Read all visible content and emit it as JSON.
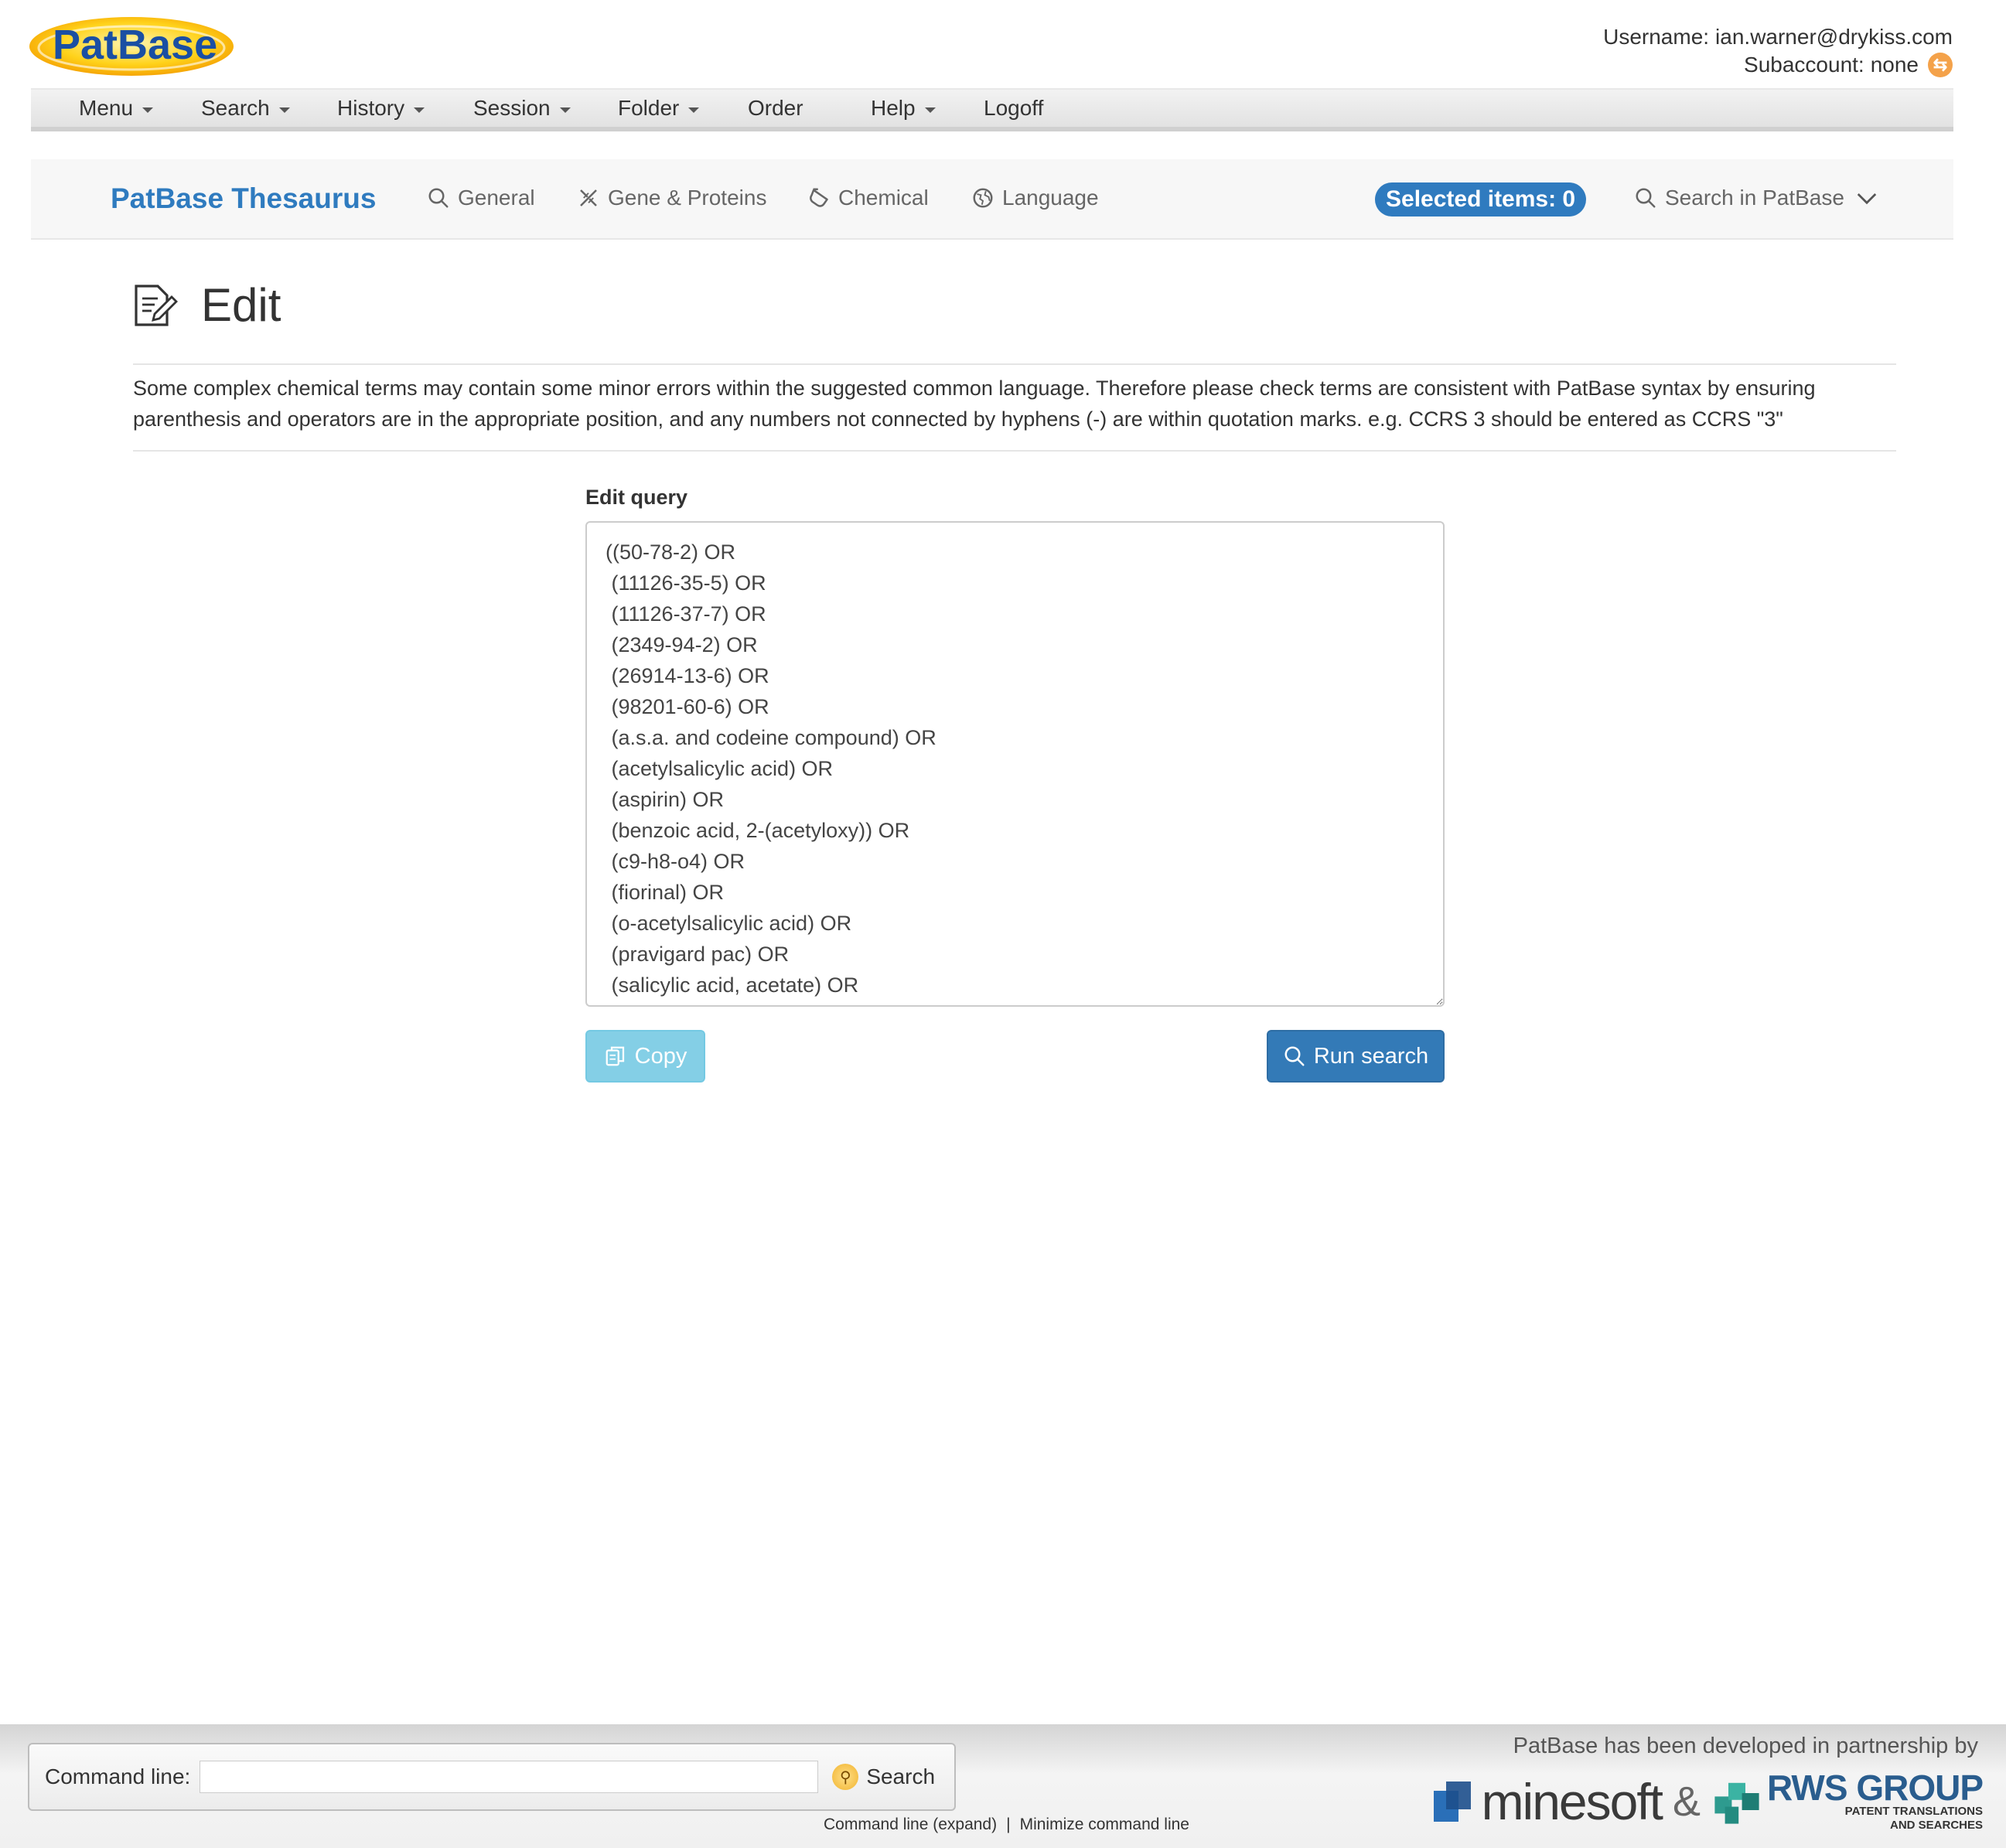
{
  "header": {
    "logo_text": "PatBase",
    "username_label": "Username:",
    "username": "ian.warner@drykiss.com",
    "subaccount_label": "Subaccount:",
    "subaccount": "none"
  },
  "menubar": {
    "items": [
      {
        "label": "Menu",
        "dropdown": true
      },
      {
        "label": "Search",
        "dropdown": true
      },
      {
        "label": "History",
        "dropdown": true
      },
      {
        "label": "Session",
        "dropdown": true
      },
      {
        "label": "Folder",
        "dropdown": true
      },
      {
        "label": "Order",
        "dropdown": false
      },
      {
        "label": "Help",
        "dropdown": true
      },
      {
        "label": "Logoff",
        "dropdown": false
      }
    ]
  },
  "thesaurus_nav": {
    "brand": "PatBase Thesaurus",
    "links": [
      {
        "label": "General",
        "icon": "search-icon"
      },
      {
        "label": "Gene & Proteins",
        "icon": "dna-icon"
      },
      {
        "label": "Chemical",
        "icon": "test-tube-icon"
      },
      {
        "label": "Language",
        "icon": "globe-icon"
      }
    ],
    "selected_items": "Selected items: 0",
    "search_in": "Search in PatBase"
  },
  "page": {
    "title": "Edit",
    "notice": "Some complex chemical terms may contain some minor errors within the suggested common language. Therefore please check terms are consistent with PatBase syntax by ensuring parenthesis and operators are in the appropriate position, and any numbers not connected by hyphens (-) are within quotation marks. e.g. CCRS 3 should be entered as CCRS \"3\"",
    "edit_label": "Edit query",
    "query": "((50-78-2) OR\n (11126-35-5) OR\n (11126-37-7) OR\n (2349-94-2) OR\n (26914-13-6) OR\n (98201-60-6) OR\n (a.s.a. and codeine compound) OR\n (acetylsalicylic acid) OR\n (aspirin) OR\n (benzoic acid, 2-(acetyloxy)) OR\n (c9-h8-o4) OR\n (fiorinal) OR\n (o-acetylsalicylic acid) OR\n (pravigard pac) OR\n (salicylic acid, acetate) OR",
    "copy_label": "Copy",
    "run_label": "Run search"
  },
  "footer": {
    "command_label": "Command line:",
    "command_value": "",
    "search_label": "Search",
    "expand_link": "Command line (expand)",
    "separator": "|",
    "minimize_link": "Minimize command line",
    "partner_text": "PatBase has been developed in partnership by",
    "minesoft": "minesoft",
    "amp": "&",
    "rws_main": "RWS GROUP",
    "rws_sub1": "PATENT TRANSLATIONS",
    "rws_sub2": "AND SEARCHES"
  },
  "colors": {
    "brand_blue": "#2f7bbf",
    "copy_button": "#5bc0de",
    "run_button": "#337ab7",
    "switch_orange": "#f4a24a"
  }
}
